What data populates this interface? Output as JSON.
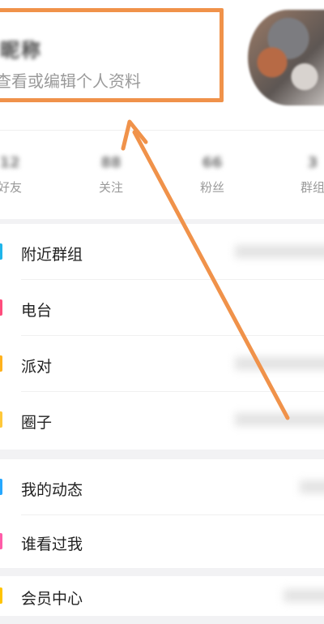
{
  "profile": {
    "name": "昵称",
    "subtitle": "查看或编辑个人资料"
  },
  "stats": [
    {
      "value": "12",
      "label": "好友"
    },
    {
      "value": "88",
      "label": "关注"
    },
    {
      "value": "66",
      "label": "粉丝"
    },
    {
      "value": "3",
      "label": "群组"
    }
  ],
  "menu_group1": [
    {
      "label": "附近群组",
      "icon": "group-icon",
      "color": "#1fb5ea"
    },
    {
      "label": "电台",
      "icon": "radio-icon",
      "color": "#ff4d7d"
    },
    {
      "label": "派对",
      "icon": "party-icon",
      "color": "#ffb21d"
    },
    {
      "label": "圈子",
      "icon": "circle-icon",
      "color": "#ffc83a"
    }
  ],
  "menu_group2": [
    {
      "label": "我的动态",
      "icon": "feed-icon",
      "color": "#26a8ff"
    },
    {
      "label": "谁看过我",
      "icon": "visitor-icon",
      "color": "#ff5ca8"
    }
  ],
  "menu_group3": [
    {
      "label": "会员中心",
      "icon": "vip-icon",
      "color": "#ffc400"
    }
  ],
  "annotation": {
    "box_color": "#f0924a",
    "arrow_color": "#f0924a"
  }
}
